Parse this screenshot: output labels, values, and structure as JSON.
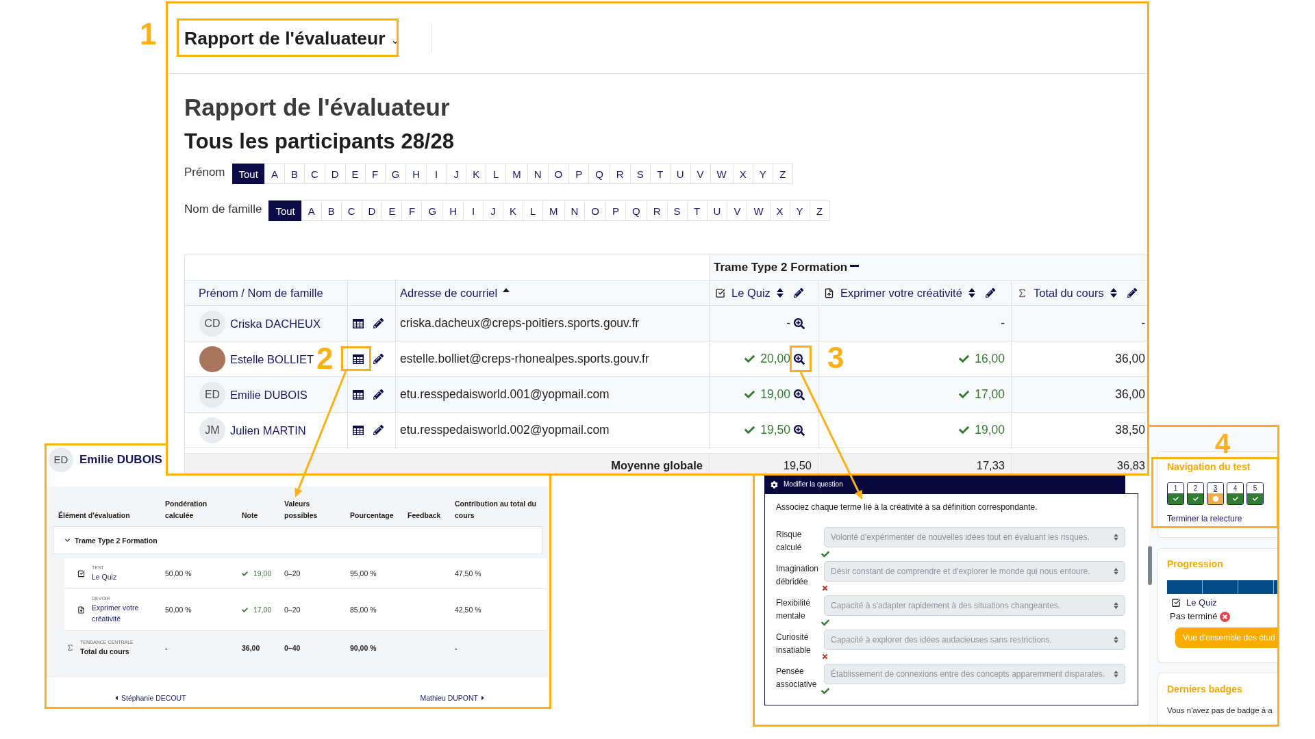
{
  "callouts": [
    {
      "label": "1",
      "kind": "report-menu"
    },
    {
      "label": "2",
      "kind": "user-report"
    },
    {
      "label": "3",
      "kind": "grade-analysis"
    },
    {
      "label": "4",
      "kind": "quiz-navigation"
    }
  ],
  "grader_report": {
    "report_menu": {
      "label": "Rapport de l'évaluateur"
    },
    "title": "Rapport de l'évaluateur",
    "subtitle": "Tous les participants 28/28",
    "initials_filters": [
      {
        "label": "Prénom",
        "options": [
          {
            "label": "Tout",
            "selected": true
          },
          {
            "label": "A",
            "selected": false
          },
          {
            "label": "B",
            "selected": false
          },
          {
            "label": "C",
            "selected": false
          },
          {
            "label": "D",
            "selected": false
          },
          {
            "label": "E",
            "selected": false
          },
          {
            "label": "F",
            "selected": false
          },
          {
            "label": "G",
            "selected": false
          },
          {
            "label": "H",
            "selected": false
          },
          {
            "label": "I",
            "selected": false
          },
          {
            "label": "J",
            "selected": false
          },
          {
            "label": "K",
            "selected": false
          },
          {
            "label": "L",
            "selected": false
          },
          {
            "label": "M",
            "selected": false
          },
          {
            "label": "N",
            "selected": false
          },
          {
            "label": "O",
            "selected": false
          },
          {
            "label": "P",
            "selected": false
          },
          {
            "label": "Q",
            "selected": false
          },
          {
            "label": "R",
            "selected": false
          },
          {
            "label": "S",
            "selected": false
          },
          {
            "label": "T",
            "selected": false
          },
          {
            "label": "U",
            "selected": false
          },
          {
            "label": "V",
            "selected": false
          },
          {
            "label": "W",
            "selected": false
          },
          {
            "label": "X",
            "selected": false
          },
          {
            "label": "Y",
            "selected": false
          },
          {
            "label": "Z",
            "selected": false
          }
        ]
      },
      {
        "label": "Nom de famille",
        "options": [
          {
            "label": "Tout",
            "selected": true
          },
          {
            "label": "A",
            "selected": false
          },
          {
            "label": "B",
            "selected": false
          },
          {
            "label": "C",
            "selected": false
          },
          {
            "label": "D",
            "selected": false
          },
          {
            "label": "E",
            "selected": false
          },
          {
            "label": "F",
            "selected": false
          },
          {
            "label": "G",
            "selected": false
          },
          {
            "label": "H",
            "selected": false
          },
          {
            "label": "I",
            "selected": false
          },
          {
            "label": "J",
            "selected": false
          },
          {
            "label": "K",
            "selected": false
          },
          {
            "label": "L",
            "selected": false
          },
          {
            "label": "M",
            "selected": false
          },
          {
            "label": "N",
            "selected": false
          },
          {
            "label": "O",
            "selected": false
          },
          {
            "label": "P",
            "selected": false
          },
          {
            "label": "Q",
            "selected": false
          },
          {
            "label": "R",
            "selected": false
          },
          {
            "label": "S",
            "selected": false
          },
          {
            "label": "T",
            "selected": false
          },
          {
            "label": "U",
            "selected": false
          },
          {
            "label": "V",
            "selected": false
          },
          {
            "label": "W",
            "selected": false
          },
          {
            "label": "X",
            "selected": false
          },
          {
            "label": "Y",
            "selected": false
          },
          {
            "label": "Z",
            "selected": false
          }
        ]
      }
    ],
    "table": {
      "category": {
        "label": "Trame Type 2 Formation",
        "expanded": true
      },
      "columns": [
        {
          "kind": "name",
          "label": "Prénom / Nom de famille"
        },
        {
          "kind": "email",
          "label": "Adresse de courriel",
          "sorted": true
        },
        {
          "kind": "quiz",
          "label": "Le Quiz",
          "sorted": false
        },
        {
          "kind": "assignment",
          "label": "Exprimer votre créativité",
          "sorted": false
        },
        {
          "kind": "total",
          "label": "Total du cours",
          "sorted": false
        }
      ],
      "rows": [
        {
          "avatar": {
            "kind": "initials",
            "initials": "CD"
          },
          "name": "Criska DACHEUX",
          "email": "criska.dacheux@creps-poitiers.sports.gouv.fr",
          "grades": [
            {
              "value": "-",
              "passed": false
            },
            {
              "value": "-",
              "passed": false
            },
            {
              "value": "-",
              "passed": false
            }
          ]
        },
        {
          "avatar": {
            "kind": "photo"
          },
          "name": "Estelle BOLLIET",
          "email": "estelle.bolliet@creps-rhonealpes.sports.gouv.fr",
          "grades": [
            {
              "value": "20,00",
              "passed": true
            },
            {
              "value": "16,00",
              "passed": true
            },
            {
              "value": "36,00",
              "passed": false
            }
          ]
        },
        {
          "avatar": {
            "kind": "initials",
            "initials": "ED"
          },
          "name": "Emilie DUBOIS",
          "email": "etu.resspedaisworld.001@yopmail.com",
          "grades": [
            {
              "value": "19,00",
              "passed": true
            },
            {
              "value": "17,00",
              "passed": true
            },
            {
              "value": "36,00",
              "passed": false
            }
          ]
        },
        {
          "avatar": {
            "kind": "initials",
            "initials": "JM"
          },
          "name": "Julien MARTIN",
          "email": "etu.resspedaisworld.002@yopmail.com",
          "grades": [
            {
              "value": "19,50",
              "passed": true
            },
            {
              "value": "19,00",
              "passed": true
            },
            {
              "value": "38,50",
              "passed": false
            }
          ]
        }
      ],
      "footer": {
        "label": "Moyenne globale",
        "values": [
          "19,50",
          "17,33",
          "36,83"
        ]
      }
    }
  },
  "user_report": {
    "initials": "ED",
    "name": "Emilie DUBOIS",
    "columns": [
      "Élément d'évaluation",
      "Pondération calculée",
      "Note",
      "Valeurs possibles",
      "Pourcentage",
      "Feedback",
      "Contribution au total du cours"
    ],
    "category": {
      "label": "Trame Type 2 Formation",
      "expanded": true,
      "children": [
        {
          "kind": "quiz",
          "type": "TEST",
          "name": "Le Quiz",
          "weight": "50,00 %",
          "grade": "19,00",
          "passed": true,
          "range": "0–20",
          "percentage": "95,00 %",
          "contribution": "47,50 %"
        },
        {
          "kind": "assignment",
          "type": "DEVOIR",
          "name": "Exprimer votre créativité",
          "weight": "50,00 %",
          "grade": "17,00",
          "passed": true,
          "range": "0–20",
          "percentage": "85,00 %",
          "contribution": "42,50 %"
        }
      ]
    },
    "total": {
      "type": "TENDANCE CENTRALE",
      "name": "Total du cours",
      "weight": "-",
      "grade": "36,00",
      "range": "0–40",
      "percentage": "90,00 %",
      "contribution": "-"
    },
    "previous": "Stéphanie DECOUT",
    "next": "Mathieu DUPONT"
  },
  "question_preview": {
    "header": "Modifier la question",
    "prompt": "Associez chaque terme lié à la créativité à sa définition correspondante.",
    "pairs": [
      {
        "term": "Risque calculé",
        "answer": "Volonté d'expérimenter de nouvelles idées tout en évaluant les risques.",
        "disabled": true,
        "correct": true
      },
      {
        "term": "Imagination débridée",
        "answer": "Désir constant de comprendre et d'explorer le monde qui nous entoure.",
        "disabled": true,
        "correct": false
      },
      {
        "term": "Flexibilité mentale",
        "answer": "Capacité à s'adapter rapidement à des situations changeantes.",
        "disabled": true,
        "correct": true
      },
      {
        "term": "Curiosité insatiable",
        "answer": "Capacité à explorer des idées audacieuses sans restrictions.",
        "disabled": true,
        "correct": false
      },
      {
        "term": "Pensée associative",
        "answer": "Établissement de connexions entre des concepts apparemment disparates.",
        "disabled": true,
        "correct": true
      }
    ]
  },
  "quiz_sidebar": {
    "navigation": {
      "title": "Navigation du test",
      "questions": [
        {
          "label": "1",
          "kind": "correct",
          "selected": false
        },
        {
          "label": "2",
          "kind": "correct",
          "selected": false
        },
        {
          "label": "3",
          "kind": "partial",
          "selected": true
        },
        {
          "label": "4",
          "kind": "correct",
          "selected": false
        },
        {
          "label": "5",
          "kind": "correct",
          "selected": false
        }
      ],
      "finish_link": "Terminer la relecture"
    },
    "progress": {
      "title": "Progression",
      "level": 1,
      "activity": "Le Quiz",
      "status": "Pas terminé",
      "completed": false,
      "button": "Vue d'ensemble des étud"
    },
    "badges": {
      "title": "Derniers badges",
      "message": "Vous n'avez pas de badge à a"
    }
  }
}
